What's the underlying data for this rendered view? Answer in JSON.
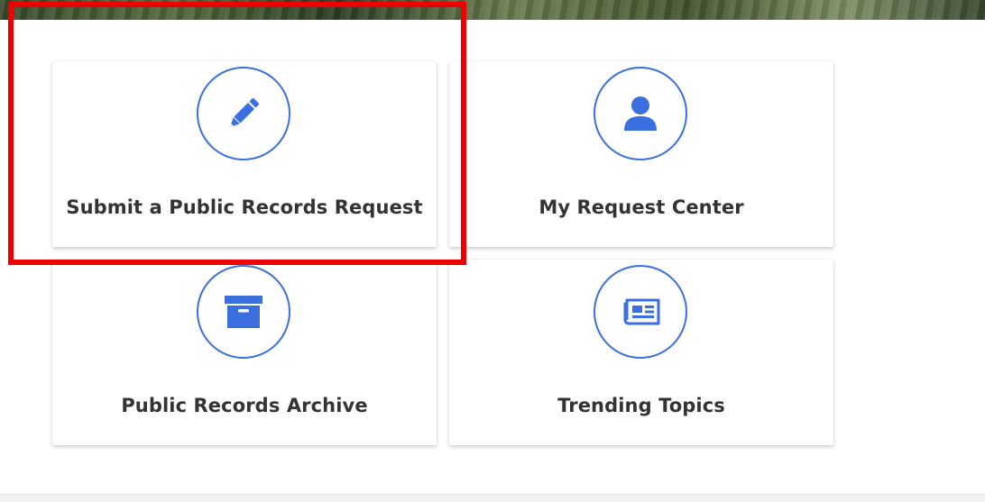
{
  "colors": {
    "accent": "#3b6fe0",
    "label": "#333333",
    "highlight": "#ee0000"
  },
  "tiles": [
    {
      "label": "Submit a Public Records Request",
      "icon": "pencil-icon"
    },
    {
      "label": "My Request Center",
      "icon": "user-icon"
    },
    {
      "label": "Public Records Archive",
      "icon": "archive-box-icon"
    },
    {
      "label": "Trending Topics",
      "icon": "newspaper-icon"
    }
  ]
}
